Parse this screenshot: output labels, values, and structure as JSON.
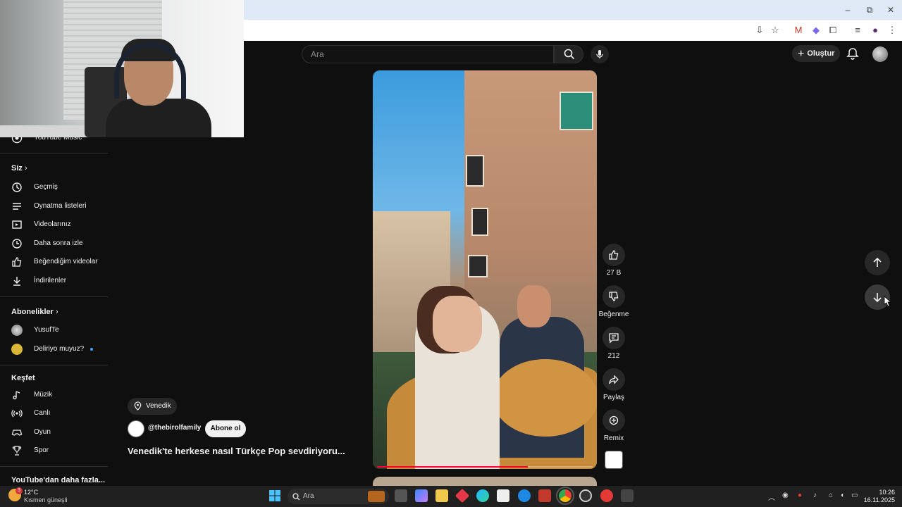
{
  "browser": {
    "window_controls": {
      "minimize": "–",
      "maximize": "⧉",
      "close": "✕"
    }
  },
  "header": {
    "search_placeholder": "Ara",
    "create_label": "Oluştur"
  },
  "sidebar": {
    "top_item": "YouTube Music",
    "you": {
      "heading": "Siz",
      "items": [
        {
          "label": "Geçmiş",
          "icon": "history-icon"
        },
        {
          "label": "Oynatma listeleri",
          "icon": "playlist-icon"
        },
        {
          "label": "Videolarınız",
          "icon": "your-videos-icon"
        },
        {
          "label": "Daha sonra izle",
          "icon": "watch-later-icon"
        },
        {
          "label": "Beğendiğim videolar",
          "icon": "liked-icon"
        },
        {
          "label": "İndirilenler",
          "icon": "download-icon"
        }
      ]
    },
    "subscriptions": {
      "heading": "Abonelikler",
      "items": [
        {
          "label": "YusufTe"
        },
        {
          "label": "Deliriyo muyuz?"
        }
      ]
    },
    "explore": {
      "heading": "Keşfet",
      "items": [
        {
          "label": "Müzik",
          "icon": "music-icon"
        },
        {
          "label": "Canlı",
          "icon": "live-icon"
        },
        {
          "label": "Oyun",
          "icon": "gaming-icon"
        },
        {
          "label": "Spor",
          "icon": "sports-icon"
        }
      ]
    },
    "more_heading": "YouTube'dan daha fazla..."
  },
  "short": {
    "location": "Venedik",
    "channel": "@thebirolfamily",
    "subscribe_label": "Abone ol",
    "title": "Venedik'te herkese nasıl Türkçe Pop sevdiriyoru...",
    "progress": 0.7
  },
  "actions": {
    "likes": "27 B",
    "dislike_label": "Beğenme",
    "comments": "212",
    "share_label": "Paylaş",
    "remix_label": "Remix"
  },
  "taskbar": {
    "weather_temp": "12°C",
    "weather_desc": "Kısmen güneşli",
    "weather_badge": "3",
    "search_placeholder": "Ara",
    "time": "10:26",
    "date": "16.11.2025"
  },
  "colors": {
    "background": "#0f0f0f",
    "accent": "#ff0033",
    "chip": "#272727"
  }
}
